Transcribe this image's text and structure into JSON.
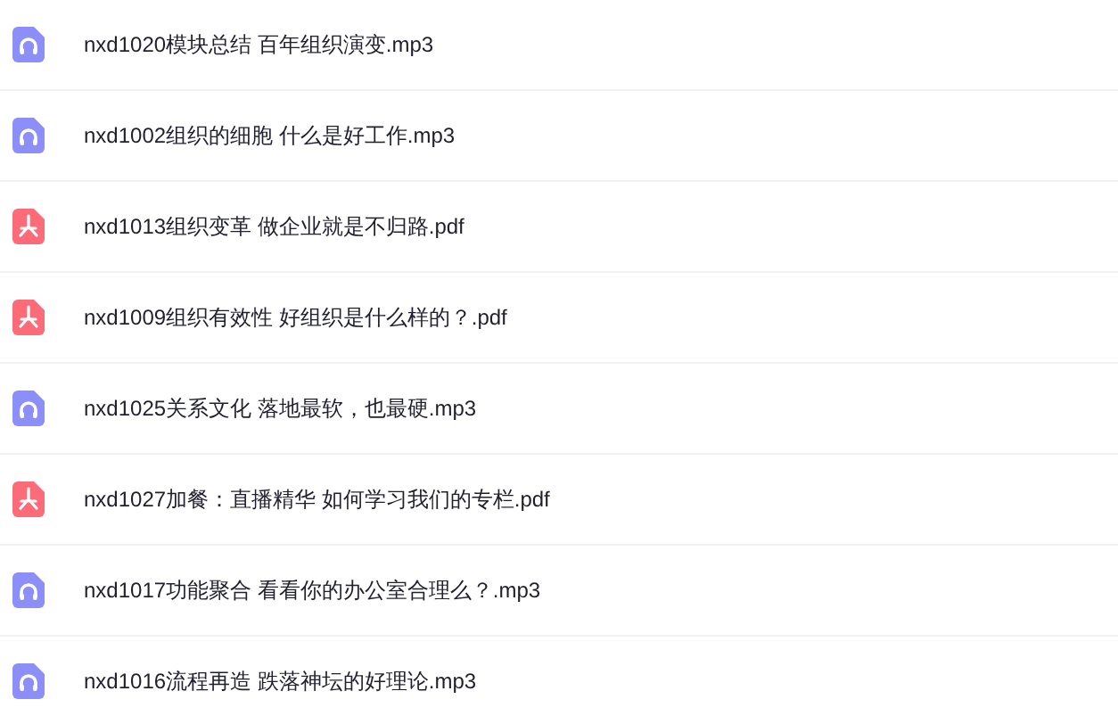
{
  "files": [
    {
      "kind": "audio",
      "name": "nxd1020模块总结 百年组织演变.mp3"
    },
    {
      "kind": "audio",
      "name": "nxd1002组织的细胞 什么是好工作.mp3"
    },
    {
      "kind": "pdf",
      "name": "nxd1013组织变革 做企业就是不归路.pdf"
    },
    {
      "kind": "pdf",
      "name": "nxd1009组织有效性 好组织是什么样的？.pdf"
    },
    {
      "kind": "audio",
      "name": "nxd1025关系文化 落地最软，也最硬.mp3"
    },
    {
      "kind": "pdf",
      "name": "nxd1027加餐：直播精华 如何学习我们的专栏.pdf"
    },
    {
      "kind": "audio",
      "name": "nxd1017功能聚合 看看你的办公室合理么？.mp3"
    },
    {
      "kind": "audio",
      "name": "nxd1016流程再造 跌落神坛的好理论.mp3"
    }
  ]
}
